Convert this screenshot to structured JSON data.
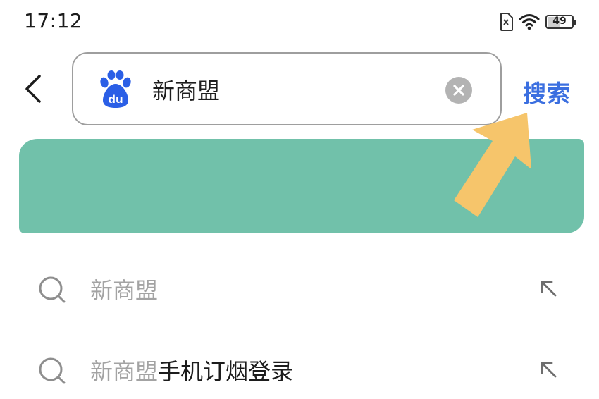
{
  "status_bar": {
    "time": "17:12",
    "battery_level": "49",
    "icons": [
      "sim-card-icon",
      "wifi-icon",
      "battery-icon"
    ]
  },
  "search_header": {
    "back_icon": "chevron-left-icon",
    "engine_logo": "baidu-paw-logo",
    "engine_logo_text": "du",
    "query": "新商盟",
    "clear_icon": "clear-circle-icon",
    "submit_label": "搜索"
  },
  "colors": {
    "accent": "#3b6fe0",
    "banner": "#71c1aa",
    "annotation_arrow": "#f6c56b",
    "baidu_blue": "#2b5fe6",
    "muted_text": "#a3a3a3"
  },
  "suggestions": [
    {
      "match": "新商盟",
      "rest": "",
      "icon": "search-icon",
      "action_icon": "fill-query-arrow-icon"
    },
    {
      "match": "新商盟",
      "rest": "手机订烟登录",
      "icon": "search-icon",
      "action_icon": "fill-query-arrow-icon"
    }
  ]
}
